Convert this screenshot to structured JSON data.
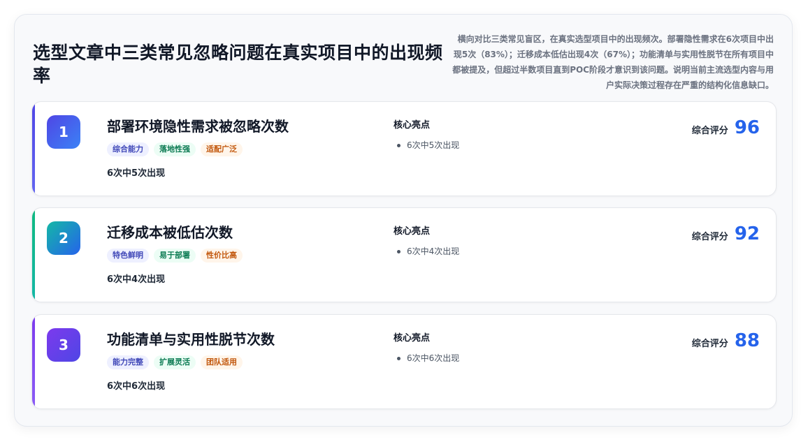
{
  "header": {
    "title": "选型文章中三类常见忽略问题在真实项目中的出现频率",
    "summary": "横向对比三类常见盲区，在真实选型项目中的出现频次。部署隐性需求在6次项目中出现5次（83%）；迁移成本低估出现4次（67%）；功能清单与实用性脱节在所有项目中都被提及，但超过半数项目直到POC阶段才意识到该问题。说明当前主流选型内容与用户实际决策过程存在严重的结构化信息缺口。"
  },
  "labels": {
    "highlights": "核心亮点",
    "score": "综合评分"
  },
  "colors": {
    "score": "#2563eb",
    "card1_accent": "#4f46e5",
    "card2_accent": "#10b981",
    "card3_accent": "#7c3aed"
  },
  "cards": [
    {
      "rank": "1",
      "title": "部署环境隐性需求被忽略次数",
      "tags": [
        "综合能力",
        "落地性强",
        "适配广泛"
      ],
      "frequency": "6次中5次出现",
      "highlight": "6次中5次出现",
      "score": "96"
    },
    {
      "rank": "2",
      "title": "迁移成本被低估次数",
      "tags": [
        "特色鲜明",
        "易于部署",
        "性价比高"
      ],
      "frequency": "6次中4次出现",
      "highlight": "6次中4次出现",
      "score": "92"
    },
    {
      "rank": "3",
      "title": "功能清单与实用性脱节次数",
      "tags": [
        "能力完整",
        "扩展灵活",
        "团队适用"
      ],
      "frequency": "6次中6次出现",
      "highlight": "6次中6次出现",
      "score": "88"
    }
  ]
}
